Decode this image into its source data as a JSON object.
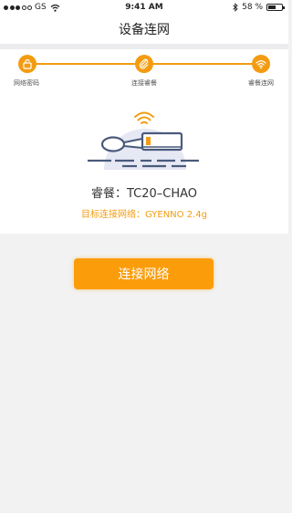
{
  "status_bar": {
    "carrier": "GS",
    "time": "9:41 AM",
    "battery": "58 %",
    "battery_level": 0.58
  },
  "nav": {
    "title": "设备连网"
  },
  "steps": [
    {
      "label": "网络密码",
      "icon": "lock-icon"
    },
    {
      "label": "连接睿餐",
      "icon": "link-icon"
    },
    {
      "label": "睿餐连网",
      "icon": "wifi-icon"
    }
  ],
  "device": {
    "name": "睿餐：TC20–CHAO",
    "target_network": "目标连接网络：GYENNO 2.4g"
  },
  "actions": {
    "connect_label": "连接网络"
  },
  "colors": {
    "accent": "#f39c12",
    "button": "#fb9d0b",
    "illustration": "#4a5a7c"
  }
}
